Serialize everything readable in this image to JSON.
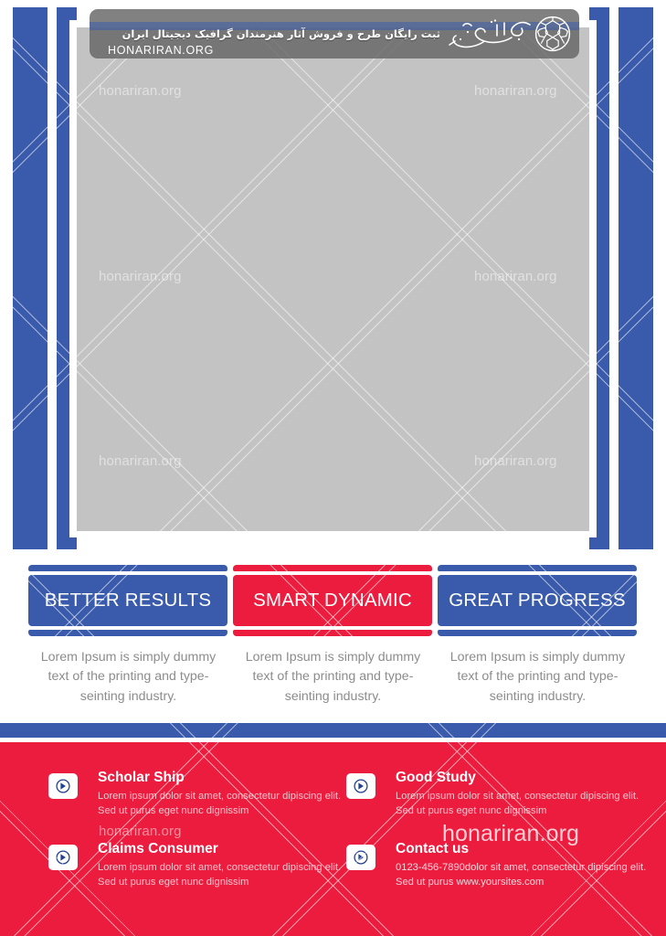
{
  "brand": {
    "site": "honariran.org",
    "site_upper": "HONARIRAN.ORG",
    "persian_tagline": "ثبت رایگان طرح و فروش آثار هنرمندان گرافیک دیجیتال ایران",
    "logo_name": "نمایشگاه هنر ایران",
    "colors": {
      "blue": "#3a5bab",
      "red": "#ec1c3e",
      "photo_gray": "#c3c3c3",
      "badge_gray": "#656565",
      "desc_gray": "#8c8c8c"
    }
  },
  "feature_boxes": [
    {
      "label": "BETTER RESULTS",
      "color": "#3a5bab",
      "variant": "blue",
      "description": "Lorem Ipsum is simply dummy text of the printing and type-seinting industry."
    },
    {
      "label": "SMART DYNAMIC",
      "color": "#ec1c3e",
      "variant": "red",
      "description": "Lorem Ipsum is simply dummy text of the printing and type-seinting industry."
    },
    {
      "label": "GREAT PROGRESS",
      "color": "#3a5bab",
      "variant": "blue",
      "description": "Lorem Ipsum is simply dummy text of the printing and type-seinting industry."
    }
  ],
  "footer": {
    "items": [
      {
        "title": "Scholar Ship",
        "description": "Lorem ipsum dolor sit amet, consectetur dipiscing elit. Sed ut purus eget nunc dignissim",
        "icon": "arrow-circle-right-icon"
      },
      {
        "title": "Good Study",
        "description": "Lorem ipsum dolor sit amet, consectetur dipiscing elit. Sed ut purus eget nunc dignissim",
        "icon": "arrow-circle-right-icon"
      },
      {
        "title": "Claims Consumer",
        "description": "Lorem ipsum dolor sit amet, consectetur dipiscing elit. Sed ut purus eget nunc dignissim",
        "icon": "arrow-circle-right-icon"
      },
      {
        "title": "Contact us",
        "description": "0123-456-7890dolor sit amet, consectetur dipiscing elit. Sed ut purus www.yoursites.com",
        "icon": "arrow-circle-right-icon"
      }
    ]
  },
  "watermarks": {
    "label": "honariran.org"
  }
}
